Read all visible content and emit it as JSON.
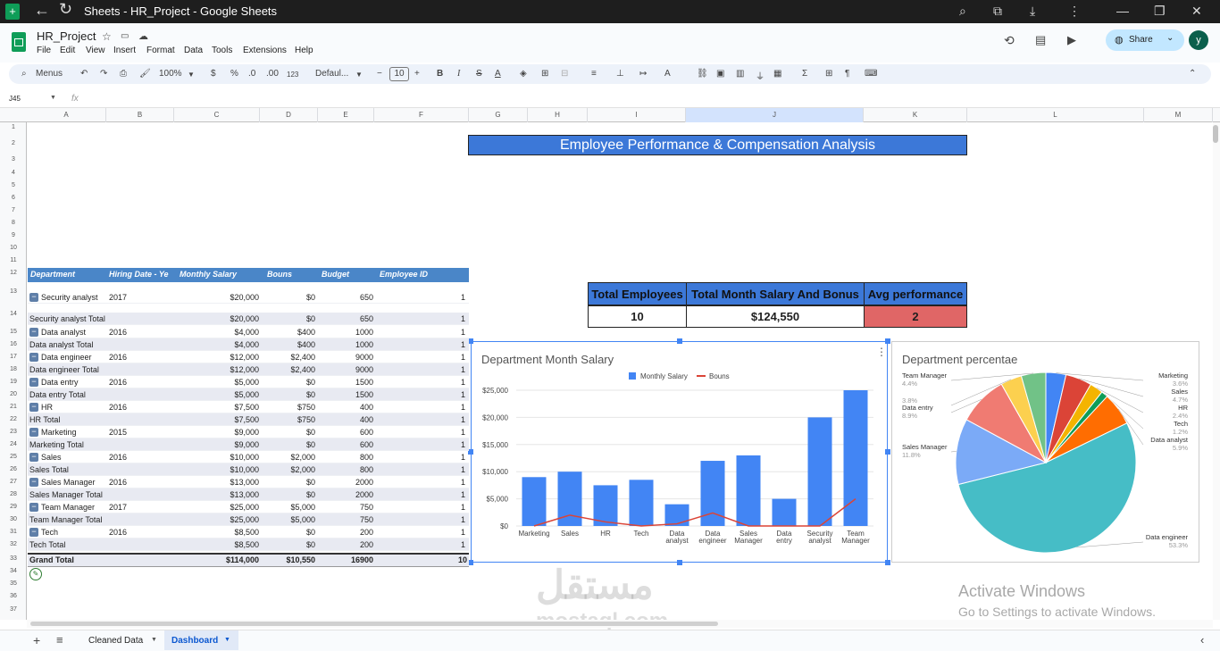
{
  "window": {
    "title": "Sheets - HR_Project - Google Sheets"
  },
  "doc": {
    "title": "HR_Project"
  },
  "menu": [
    "File",
    "Edit",
    "View",
    "Insert",
    "Format",
    "Data",
    "Tools",
    "Extensions",
    "Help"
  ],
  "toolbar": {
    "menus": "Menus",
    "zoom": "100%",
    "currency": "$",
    "percent": "%",
    "dec_less": ".0",
    "dec_more": ".00",
    "num_format": "123",
    "font": "Defaul...",
    "font_size": "10",
    "bold": "B",
    "italic": "I"
  },
  "share": {
    "label": "Share"
  },
  "avatar": {
    "letter": "y"
  },
  "namebox": "J45",
  "fx": "fx",
  "columns": [
    "A",
    "B",
    "C",
    "D",
    "E",
    "F",
    "G",
    "H",
    "I",
    "J",
    "K",
    "L",
    "M"
  ],
  "rows": [
    "1",
    "2",
    "3",
    "4",
    "5",
    "6",
    "7",
    "8",
    "9",
    "10",
    "11",
    "12",
    "13",
    "14",
    "15",
    "16",
    "17",
    "18",
    "19",
    "20",
    "21",
    "22",
    "23",
    "24",
    "25",
    "26",
    "27",
    "28",
    "29",
    "30",
    "31",
    "32",
    "33",
    "34",
    "35",
    "36",
    "37"
  ],
  "banner": "Employee Performance & Compensation Analysis",
  "pivot": {
    "headers": [
      "Department",
      "Hiring Date - Ye",
      "Monthly Salary",
      "Bouns",
      "Budget",
      "Employee ID"
    ],
    "rows": [
      {
        "d": "Security analyst",
        "y": "2017",
        "s": "$20,000",
        "b": "$0",
        "bu": "650",
        "id": "1",
        "group": true
      },
      {
        "d": "Security analyst Total",
        "y": "",
        "s": "$20,000",
        "b": "$0",
        "bu": "650",
        "id": "1",
        "total": true
      },
      {
        "d": "Data analyst",
        "y": "2016",
        "s": "$4,000",
        "b": "$400",
        "bu": "1000",
        "id": "1",
        "group": true
      },
      {
        "d": "Data analyst Total",
        "y": "",
        "s": "$4,000",
        "b": "$400",
        "bu": "1000",
        "id": "1",
        "total": true
      },
      {
        "d": "Data engineer",
        "y": "2016",
        "s": "$12,000",
        "b": "$2,400",
        "bu": "9000",
        "id": "1",
        "group": true
      },
      {
        "d": "Data engineer Total",
        "y": "",
        "s": "$12,000",
        "b": "$2,400",
        "bu": "9000",
        "id": "1",
        "total": true
      },
      {
        "d": "Data entry",
        "y": "2016",
        "s": "$5,000",
        "b": "$0",
        "bu": "1500",
        "id": "1",
        "group": true
      },
      {
        "d": "Data entry Total",
        "y": "",
        "s": "$5,000",
        "b": "$0",
        "bu": "1500",
        "id": "1",
        "total": true
      },
      {
        "d": "HR",
        "y": "2016",
        "s": "$7,500",
        "b": "$750",
        "bu": "400",
        "id": "1",
        "group": true
      },
      {
        "d": "HR Total",
        "y": "",
        "s": "$7,500",
        "b": "$750",
        "bu": "400",
        "id": "1",
        "total": true
      },
      {
        "d": "Marketing",
        "y": "2015",
        "s": "$9,000",
        "b": "$0",
        "bu": "600",
        "id": "1",
        "group": true
      },
      {
        "d": "Marketing Total",
        "y": "",
        "s": "$9,000",
        "b": "$0",
        "bu": "600",
        "id": "1",
        "total": true
      },
      {
        "d": "Sales",
        "y": "2016",
        "s": "$10,000",
        "b": "$2,000",
        "bu": "800",
        "id": "1",
        "group": true
      },
      {
        "d": "Sales Total",
        "y": "",
        "s": "$10,000",
        "b": "$2,000",
        "bu": "800",
        "id": "1",
        "total": true
      },
      {
        "d": "Sales Manager",
        "y": "2016",
        "s": "$13,000",
        "b": "$0",
        "bu": "2000",
        "id": "1",
        "group": true
      },
      {
        "d": "Sales Manager Total",
        "y": "",
        "s": "$13,000",
        "b": "$0",
        "bu": "2000",
        "id": "1",
        "total": true
      },
      {
        "d": "Team Manager",
        "y": "2017",
        "s": "$25,000",
        "b": "$5,000",
        "bu": "750",
        "id": "1",
        "group": true
      },
      {
        "d": "Team Manager Total",
        "y": "",
        "s": "$25,000",
        "b": "$5,000",
        "bu": "750",
        "id": "1",
        "total": true
      },
      {
        "d": "Tech",
        "y": "2016",
        "s": "$8,500",
        "b": "$0",
        "bu": "200",
        "id": "1",
        "group": true
      },
      {
        "d": "Tech Total",
        "y": "",
        "s": "$8,500",
        "b": "$0",
        "bu": "200",
        "id": "1",
        "total": true
      }
    ],
    "grand": {
      "d": "Grand Total",
      "s": "$114,000",
      "b": "$10,550",
      "bu": "16900",
      "id": "10"
    }
  },
  "kpi": {
    "headers": [
      "Total Employees",
      "Total Month Salary And Bonus",
      "Avg performance"
    ],
    "values": [
      "10",
      "$124,550",
      "2"
    ]
  },
  "chart_data": [
    {
      "type": "bar",
      "title": "Department Month Salary",
      "categories": [
        "Marketing",
        "Sales",
        "HR",
        "Tech",
        "Data analyst",
        "Data engineer",
        "Sales Manager",
        "Data entry",
        "Security analyst",
        "Team Manager"
      ],
      "series": [
        {
          "name": "Monthly Salary",
          "type": "bar",
          "color": "#4285f4",
          "values": [
            9000,
            10000,
            7500,
            8500,
            4000,
            12000,
            13000,
            5000,
            20000,
            25000
          ]
        },
        {
          "name": "Bouns",
          "type": "line",
          "color": "#db4437",
          "values": [
            0,
            2000,
            750,
            0,
            400,
            2400,
            0,
            0,
            0,
            5000
          ]
        }
      ],
      "ylim": [
        0,
        25000
      ],
      "yticks": [
        "$0",
        "$5,000",
        "$10,000",
        "$15,000",
        "$20,000",
        "$25,000"
      ],
      "legend": "top"
    },
    {
      "type": "pie",
      "title": "Department percentae",
      "slices": [
        {
          "label": "Marketing",
          "pct": "3.6%",
          "value": 3.6,
          "color": "#4285f4"
        },
        {
          "label": "Sales",
          "pct": "4.7%",
          "value": 4.7,
          "color": "#db4437"
        },
        {
          "label": "HR",
          "pct": "2.4%",
          "value": 2.4,
          "color": "#f4b400"
        },
        {
          "label": "Tech",
          "pct": "1.2%",
          "value": 1.2,
          "color": "#0f9d58"
        },
        {
          "label": "Data analyst",
          "pct": "5.9%",
          "value": 5.9,
          "color": "#ff6d01"
        },
        {
          "label": "Data engineer",
          "pct": "53.3%",
          "value": 53.3,
          "color": "#46bdc6"
        },
        {
          "label": "Sales Manager",
          "pct": "11.8%",
          "value": 11.8,
          "color": "#7baaf7"
        },
        {
          "label": "Data entry",
          "pct": "8.9%",
          "value": 8.9,
          "color": "#f07b72"
        },
        {
          "label": "",
          "pct": "3.8%",
          "value": 3.8,
          "color": "#fcd04f"
        },
        {
          "label": "Team Manager",
          "pct": "4.4%",
          "value": 4.4,
          "color": "#71c287"
        }
      ]
    }
  ],
  "watermark": {
    "arabic": "مستقل",
    "latin": "mostaql.com"
  },
  "activation": {
    "line1": "Activate Windows",
    "line2": "Go to Settings to activate Windows."
  },
  "sheets": [
    "Cleaned Data",
    "Dashboard"
  ],
  "colors": {
    "pivot_header": "#4a86c8",
    "banner": "#3c78d8",
    "kpi_alert": "#e06666"
  }
}
